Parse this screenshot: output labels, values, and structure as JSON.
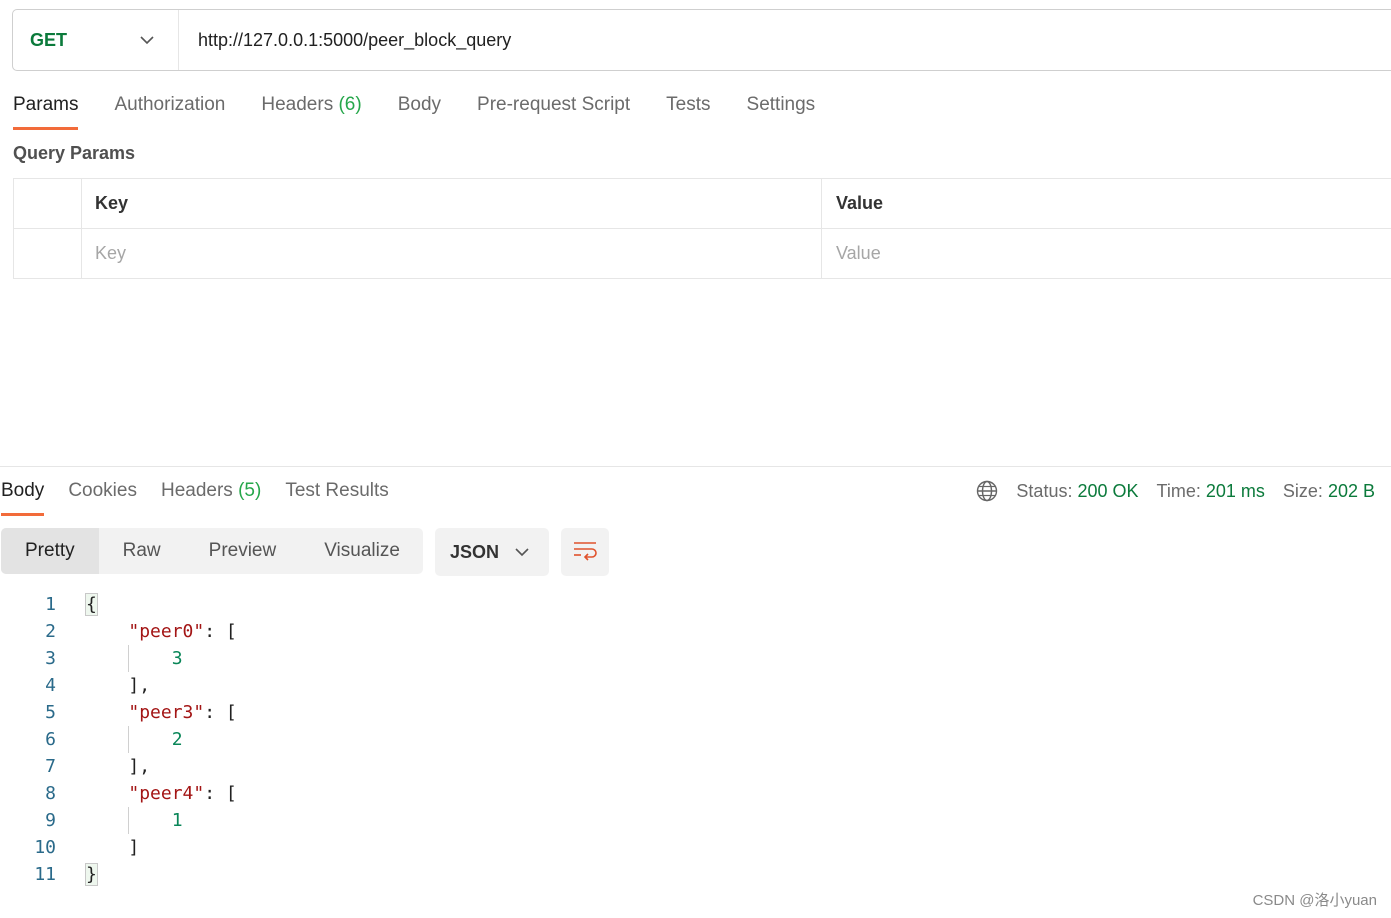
{
  "request": {
    "method": "GET",
    "url": "http://127.0.0.1:5000/peer_block_query"
  },
  "request_tabs": [
    {
      "label": "Params",
      "count": ""
    },
    {
      "label": "Authorization",
      "count": ""
    },
    {
      "label": "Headers",
      "count": "(6)"
    },
    {
      "label": "Body",
      "count": ""
    },
    {
      "label": "Pre-request Script",
      "count": ""
    },
    {
      "label": "Tests",
      "count": ""
    },
    {
      "label": "Settings",
      "count": ""
    }
  ],
  "query_params": {
    "title": "Query Params",
    "headers": {
      "key": "Key",
      "value": "Value"
    },
    "placeholders": {
      "key": "Key",
      "value": "Value"
    }
  },
  "response_tabs": [
    {
      "label": "Body",
      "count": ""
    },
    {
      "label": "Cookies",
      "count": ""
    },
    {
      "label": "Headers",
      "count": "(5)"
    },
    {
      "label": "Test Results",
      "count": ""
    }
  ],
  "status": {
    "status_label": "Status:",
    "status_value": "200 OK",
    "time_label": "Time:",
    "time_value": "201 ms",
    "size_label": "Size:",
    "size_value": "202 B"
  },
  "view_modes": [
    "Pretty",
    "Raw",
    "Preview",
    "Visualize"
  ],
  "format": "JSON",
  "code_lines": [
    {
      "n": "1",
      "text": "{"
    },
    {
      "n": "2",
      "key": "\"peer0\"",
      "text": ": ["
    },
    {
      "n": "3",
      "num": "3"
    },
    {
      "n": "4",
      "text": "],"
    },
    {
      "n": "5",
      "key": "\"peer3\"",
      "text": ": ["
    },
    {
      "n": "6",
      "num": "2"
    },
    {
      "n": "7",
      "text": "],"
    },
    {
      "n": "8",
      "key": "\"peer4\"",
      "text": ": ["
    },
    {
      "n": "9",
      "num": "1"
    },
    {
      "n": "10",
      "text": "]"
    },
    {
      "n": "11",
      "text": "}"
    }
  ],
  "watermark": "CSDN @洛小yuan",
  "colors": {
    "accent": "#f26b3a",
    "method": "#0b7a3b",
    "count": "#26a74b"
  }
}
